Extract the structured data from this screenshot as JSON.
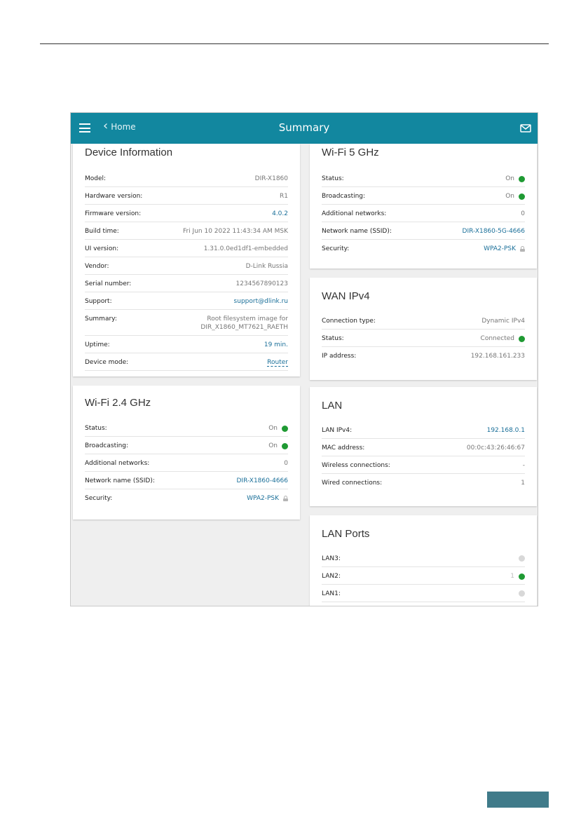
{
  "appbar": {
    "back_label": "Home",
    "title": "Summary"
  },
  "device_info": {
    "title": "Device Information",
    "rows": [
      {
        "k": "Model:",
        "v": "DIR-X1860"
      },
      {
        "k": "Hardware version:",
        "v": "R1"
      },
      {
        "k": "Firmware version:",
        "v": "4.0.2"
      },
      {
        "k": "Build time:",
        "v": "Fri Jun 10 2022 11:43:34 AM MSK"
      },
      {
        "k": "UI version:",
        "v": "1.31.0.0ed1df1-embedded"
      },
      {
        "k": "Vendor:",
        "v": "D-Link Russia"
      },
      {
        "k": "Serial number:",
        "v": "1234567890123"
      },
      {
        "k": "Support:",
        "v": "support@dlink.ru"
      },
      {
        "k": "Summary:",
        "v1": "Root filesystem image for",
        "v2": "DIR_X1860_MT7621_RAETH"
      },
      {
        "k": "Uptime:",
        "v": "19 min."
      },
      {
        "k": "Device mode:",
        "v": "Router"
      }
    ]
  },
  "wifi24": {
    "title": "Wi-Fi 2.4 GHz",
    "rows": [
      {
        "k": "Status:",
        "v": "On"
      },
      {
        "k": "Broadcasting:",
        "v": "On"
      },
      {
        "k": "Additional networks:",
        "v": "0"
      },
      {
        "k": "Network name (SSID):",
        "v": "DIR-X1860-4666"
      },
      {
        "k": "Security:",
        "v": "WPA2-PSK"
      }
    ]
  },
  "wifi5": {
    "title": "Wi-Fi 5 GHz",
    "rows": [
      {
        "k": "Status:",
        "v": "On"
      },
      {
        "k": "Broadcasting:",
        "v": "On"
      },
      {
        "k": "Additional networks:",
        "v": "0"
      },
      {
        "k": "Network name (SSID):",
        "v": "DIR-X1860-5G-4666"
      },
      {
        "k": "Security:",
        "v": "WPA2-PSK"
      }
    ]
  },
  "wan": {
    "title": "WAN IPv4",
    "rows": [
      {
        "k": "Connection type:",
        "v": "Dynamic IPv4"
      },
      {
        "k": "Status:",
        "v": "Connected"
      },
      {
        "k": "IP address:",
        "v": "192.168.161.233"
      }
    ]
  },
  "lan": {
    "title": "LAN",
    "rows": [
      {
        "k": "LAN IPv4:",
        "v": "192.168.0.1"
      },
      {
        "k": "MAC address:",
        "v": "00:0c:43:26:46:67"
      },
      {
        "k": "Wireless connections:",
        "v": "-"
      },
      {
        "k": "Wired connections:",
        "v": "1"
      }
    ]
  },
  "lan_ports": {
    "title": "LAN Ports",
    "rows": [
      {
        "k": "LAN3:",
        "v": ""
      },
      {
        "k": "LAN2:",
        "v": "1"
      },
      {
        "k": "LAN1:",
        "v": ""
      }
    ]
  },
  "colors": {
    "appbar": "#12879f",
    "status_on": "#1f9a33",
    "status_off": "#d8d8d8",
    "link": "#1a6f99",
    "footer_bar": "#407b8a"
  },
  "icons": {
    "menu": "hamburger-icon",
    "back": "chevron-left-icon",
    "mail": "mail-icon",
    "lock": "lock-icon"
  }
}
